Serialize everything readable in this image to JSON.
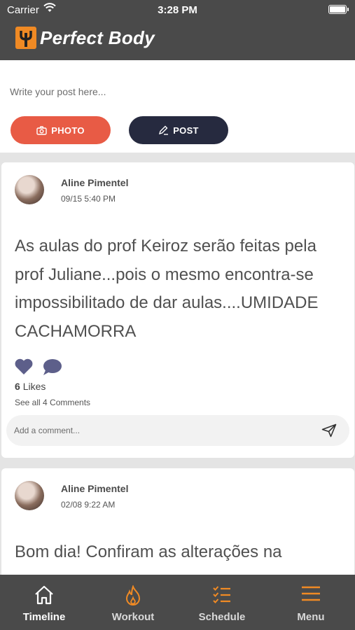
{
  "status_bar": {
    "carrier": "Carrier",
    "time": "3:28 PM"
  },
  "app": {
    "title": "Perfect Body"
  },
  "composer": {
    "placeholder": "Write your post here...",
    "photo_label": "PHOTO",
    "post_label": "POST"
  },
  "posts": [
    {
      "author": "Aline Pimentel",
      "date": "09/15 5:40 PM",
      "text": "As aulas do prof Keiroz serão feitas pela prof Juliane...pois o mesmo encontra-se impossibilitado de dar aulas....UMIDADE CACHAMORRA",
      "likes_count": "6",
      "likes_word": "Likes",
      "comments_link": "See all 4 Comments",
      "comment_placeholder": "Add a comment..."
    },
    {
      "author": "Aline Pimentel",
      "date": "02/08 9:22 AM",
      "text": "Bom dia! Confiram as alterações na"
    }
  ],
  "tabs": [
    {
      "label": "Timeline",
      "icon": "home-icon",
      "active": true
    },
    {
      "label": "Workout",
      "icon": "flame-icon",
      "active": false
    },
    {
      "label": "Schedule",
      "icon": "checklist-icon",
      "active": false
    },
    {
      "label": "Menu",
      "icon": "hamburger-icon",
      "active": false
    }
  ],
  "colors": {
    "accent": "#f08a24",
    "photo_button": "#e85b45",
    "post_button": "#262a3f",
    "bar": "#4a4a4a",
    "reaction": "#5d5f8a"
  }
}
